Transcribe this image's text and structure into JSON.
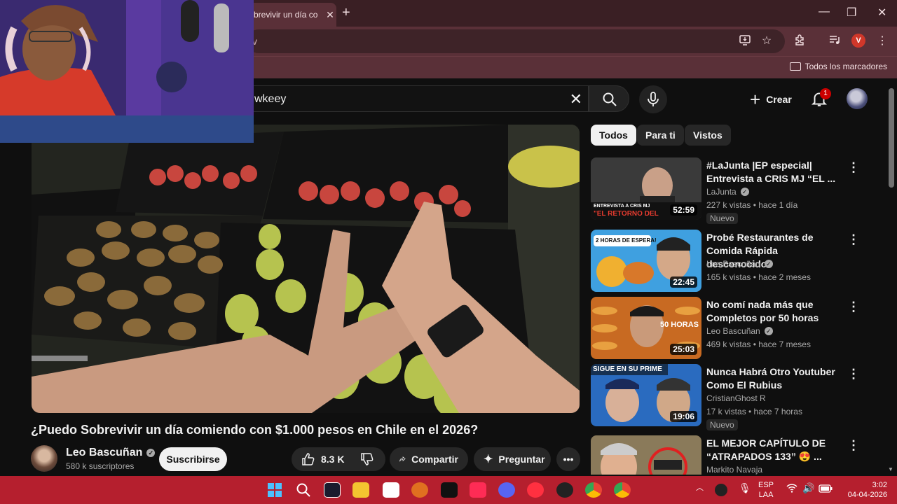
{
  "browser": {
    "tab_title": "brevivir un día co",
    "omnibox_text": "v",
    "bookmarks_label": "Todos los marcadores",
    "profile_initial": "V"
  },
  "youtube": {
    "search_value": "wkeey",
    "create_label": "Crear",
    "notifications_count": "1"
  },
  "video": {
    "title": "¿Puedo Sobrevivir un día comiendo con $1.000 pesos en Chile en el 2026?",
    "channel_name": "Leo Bascuñan",
    "subscribers": "580 k suscriptores",
    "subscribe_label": "Suscribirse",
    "likes": "8.3 K",
    "share_label": "Compartir",
    "ask_label": "Preguntar"
  },
  "filters": [
    "Todos",
    "Para ti",
    "Vistos"
  ],
  "recommendations": [
    {
      "title": "#LaJunta |EP especial| Entrevista a CRIS MJ “EL ...",
      "channel": "LaJunta",
      "meta": "227 k vistas • hace 1 día",
      "duration": "52:59",
      "badge": "Nuevo",
      "thumb_text": "ENTREVISTA A CRIS MJ",
      "thumb_text2": "\"EL RETORNO DEL"
    },
    {
      "title": "Probé Restaurantes de Comida Rápida desconocidos",
      "channel": "Leo Bascuñan",
      "meta": "165 k vistas • hace 2 meses",
      "duration": "22:45",
      "badge": "",
      "thumb_text": "2 HORAS DE ESPERA!",
      "thumb_text2": ""
    },
    {
      "title": "No comí nada más que Completos por 50 horas",
      "channel": "Leo Bascuñan",
      "meta": "469 k vistas • hace 7 meses",
      "duration": "25:03",
      "badge": "",
      "thumb_text": "50 HORAS",
      "thumb_text2": ""
    },
    {
      "title": "Nunca Habrá Otro Youtuber Como El Rubius",
      "channel": "CristianGhost R",
      "meta": "17 k vistas • hace 7 horas",
      "duration": "19:06",
      "badge": "Nuevo",
      "thumb_text": "SIGUE EN SU PRIME",
      "thumb_text2": ""
    },
    {
      "title": "EL MEJOR CAPÍTULO DE “ATRAPADOS 133” 😍 ...",
      "channel": "Markito Navaja",
      "meta": "",
      "duration": "",
      "badge": "",
      "thumb_text": "",
      "thumb_text2": ""
    }
  ],
  "taskbar": {
    "language": "ESP",
    "layout": "LAA",
    "time": "3:02",
    "date": "04-04-2026"
  }
}
